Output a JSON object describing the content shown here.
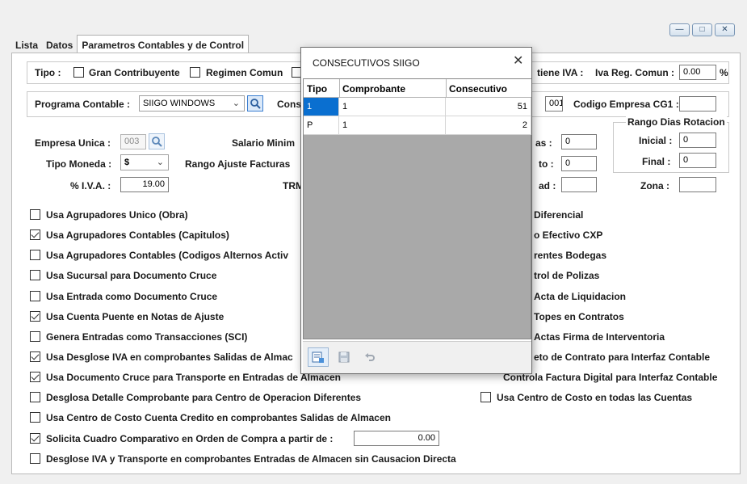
{
  "window_controls": {
    "minimize": "—",
    "maximize": "□",
    "close": "✕"
  },
  "tabs": [
    {
      "label": "Lista"
    },
    {
      "label": "Datos"
    },
    {
      "label": "Parametros Contables y de Control"
    }
  ],
  "tipo": {
    "label": "Tipo :",
    "gran_contribuyente": "Gran Contribuyente",
    "regimen_comun": "Regimen Comun",
    "retiene_iva": "tiene IVA :",
    "iva_reg_comun_label": "Iva Reg. Comun :",
    "iva_reg_comun_value": "0.00",
    "iva_pct": "%"
  },
  "programa": {
    "label": "Programa Contable :",
    "value": "SIIGO WINDOWS",
    "cons_label": "Cons",
    "cons_value": "001",
    "codigo_cg1_label": "Codigo Empresa CG1 :",
    "codigo_cg1_value": ""
  },
  "general": {
    "empresa_unica_label": "Empresa Unica :",
    "empresa_unica_value": "003",
    "salario_minimo_label": "Salario Minim",
    "tipo_moneda_label": "Tipo Moneda :",
    "tipo_moneda_value": "$",
    "rango_ajuste_label": "Rango Ajuste Facturas",
    "iva_label": "% I.V.A. :",
    "iva_value": "19.00",
    "trm_label": "TRM",
    "dias_label": "as :",
    "dias_value": "0",
    "to_label": "to :",
    "to_value": "0",
    "ad_label": "ad :",
    "ad_value": "",
    "rango_dias_title": "Rango Dias Rotacion",
    "inicial_label": "Inicial :",
    "inicial_value": "0",
    "final_label": "Final :",
    "final_value": "0",
    "zona_label": "Zona :",
    "zona_value": ""
  },
  "checkboxes_left": [
    {
      "label": "Usa Agrupadores Unico (Obra)",
      "checked": false
    },
    {
      "label": "Usa Agrupadores Contables (Capitulos)",
      "checked": true
    },
    {
      "label": "Usa Agrupadores Contables (Codigos Alternos Activ",
      "checked": false
    },
    {
      "label": "Usa Sucursal para Documento Cruce",
      "checked": false
    },
    {
      "label": "Usa Entrada como Documento Cruce",
      "checked": false
    },
    {
      "label": "Usa Cuenta Puente en Notas de Ajuste",
      "checked": true
    },
    {
      "label": "Genera Entradas como Transacciones (SCI)",
      "checked": false
    },
    {
      "label": "Usa Desglose IVA en comprobantes Salidas de Almac",
      "checked": true
    },
    {
      "label": "Usa Documento Cruce para Transporte en Entradas de Almacen",
      "checked": true
    },
    {
      "label": "Desglosa Detalle Comprobante para Centro de Operacion Diferentes",
      "checked": false
    },
    {
      "label": "Usa Centro de Costo Cuenta Credito en comprobantes Salidas de Almacen",
      "checked": false
    },
    {
      "label": "Solicita Cuadro Comparativo en Orden de Compra a partir de :",
      "checked": true
    },
    {
      "label": "Desglose IVA y Transporte en comprobantes Entradas de Almacen sin Causacion Directa",
      "checked": false
    }
  ],
  "cuadro_comparativo_value": "0.00",
  "checkboxes_right": [
    {
      "label": "Diferencial"
    },
    {
      "label": "o Efectivo CXP"
    },
    {
      "label": "rentes Bodegas"
    },
    {
      "label": "trol de Polizas"
    },
    {
      "label": "Acta de Liquidacion"
    },
    {
      "label": "Topes en Contratos"
    },
    {
      "label": "Actas Firma de Interventoria"
    },
    {
      "label": "eto de Contrato para Interfaz Contable"
    },
    {
      "label": "Controla Factura Digital para Interfaz Contable"
    },
    {
      "label": "Usa Centro de Costo en todas las Cuentas",
      "checked": false
    }
  ],
  "dialog": {
    "title": "CONSECUTIVOS SIIGO",
    "close": "✕",
    "columns": [
      "Tipo",
      "Comprobante",
      "Consecutivo"
    ],
    "rows": [
      {
        "tipo": "1",
        "comprobante": "1",
        "consecutivo": "51"
      },
      {
        "tipo": "P",
        "comprobante": "1",
        "consecutivo": "2"
      }
    ]
  }
}
